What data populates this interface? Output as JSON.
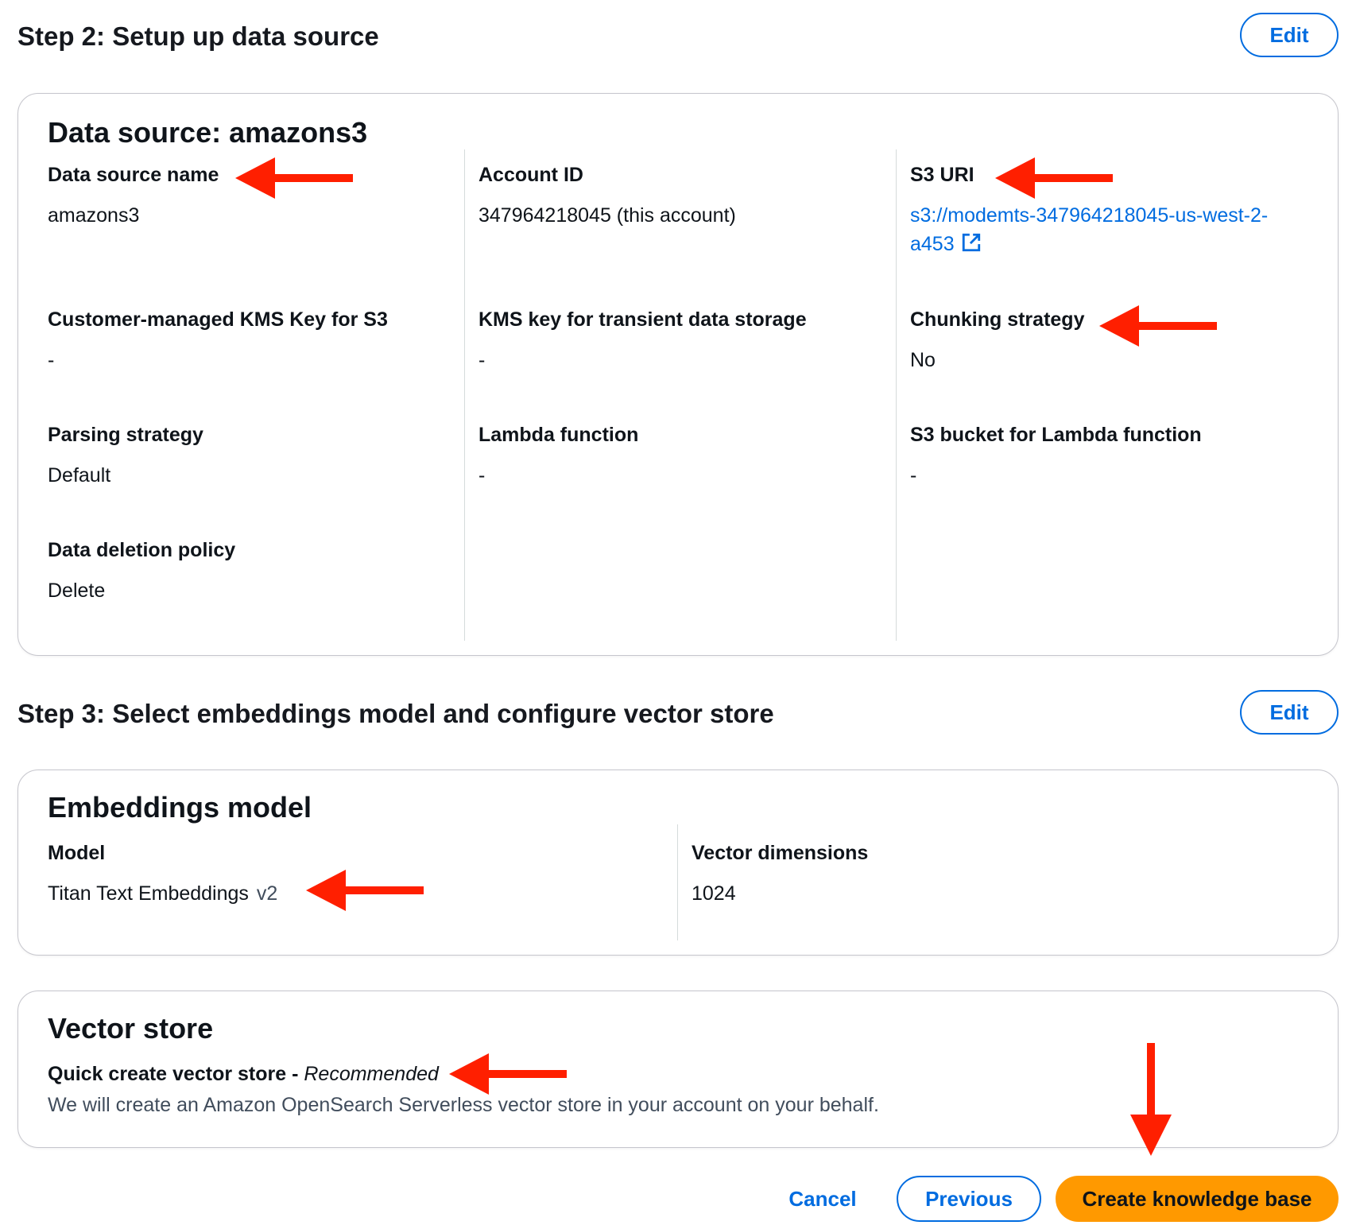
{
  "step2": {
    "title": "Step 2: Setup up data source",
    "edit_label": "Edit",
    "card": {
      "title": "Data source: amazons3",
      "fields": {
        "data_source_name": {
          "label": "Data source name",
          "value": "amazons3"
        },
        "account_id": {
          "label": "Account ID",
          "value": "347964218045 (this account)"
        },
        "s3_uri": {
          "label": "S3 URI",
          "value_line1": "s3://modemts-347964218045-us-west-2-",
          "value_line2": "a453"
        },
        "kms_s3": {
          "label": "Customer-managed KMS Key for S3",
          "value": "-"
        },
        "kms_transient": {
          "label": "KMS key for transient data storage",
          "value": "-"
        },
        "chunking": {
          "label": "Chunking strategy",
          "value": "No"
        },
        "parsing": {
          "label": "Parsing strategy",
          "value": "Default"
        },
        "lambda": {
          "label": "Lambda function",
          "value": "-"
        },
        "s3_bucket_lambda": {
          "label": "S3 bucket for Lambda function",
          "value": "-"
        },
        "deletion_policy": {
          "label": "Data deletion policy",
          "value": "Delete"
        }
      }
    }
  },
  "step3": {
    "title": "Step 3: Select embeddings model and configure vector store",
    "edit_label": "Edit",
    "embeddings_card": {
      "title": "Embeddings model",
      "model": {
        "label": "Model",
        "value": "Titan Text Embeddings",
        "version": "v2"
      },
      "dimensions": {
        "label": "Vector dimensions",
        "value": "1024"
      }
    },
    "vector_card": {
      "title": "Vector store",
      "option_label": "Quick create vector store - ",
      "option_tag": "Recommended",
      "description": "We will create an Amazon OpenSearch Serverless vector store in your account on your behalf."
    }
  },
  "footer": {
    "cancel_label": "Cancel",
    "previous_label": "Previous",
    "create_label": "Create knowledge base"
  },
  "colors": {
    "link": "#006ce0",
    "primary_button": "#ff9900",
    "annotation_arrow": "#ff1f00"
  },
  "icons": {
    "external_link": "external-link-icon",
    "annotation": "red-arrow-annotation"
  }
}
